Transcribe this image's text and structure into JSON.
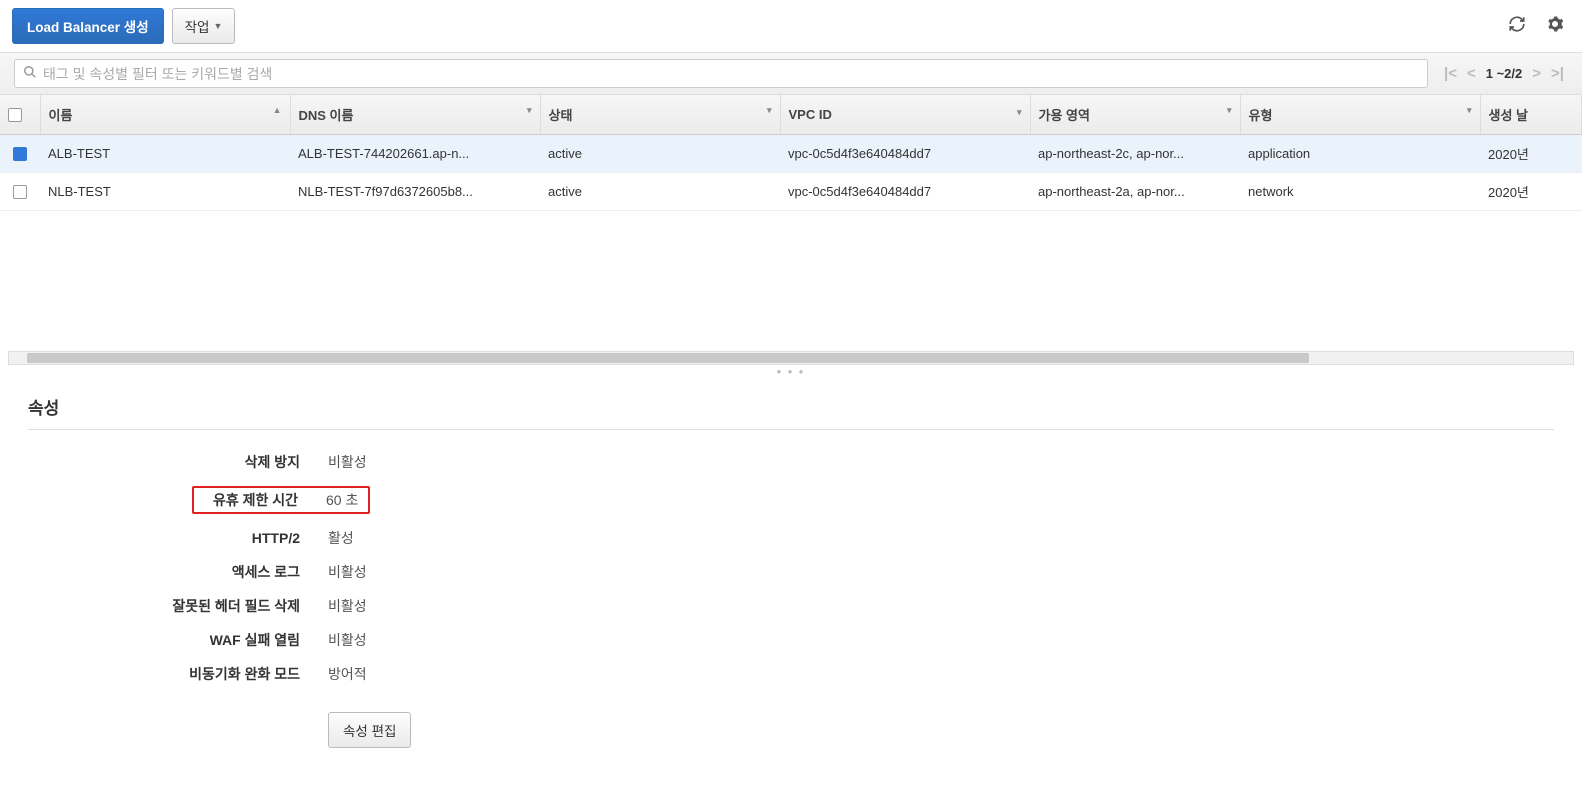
{
  "toolbar": {
    "create_label": "Load Balancer 생성",
    "actions_label": "작업"
  },
  "search": {
    "placeholder": "태그 및 속성별 필터 또는 키워드별 검색"
  },
  "pager": {
    "text": "1 ~2/2"
  },
  "columns": {
    "name": "이름",
    "dns": "DNS 이름",
    "state": "상태",
    "vpc": "VPC ID",
    "az": "가용 영역",
    "type": "유형",
    "created": "생성 날"
  },
  "rows": [
    {
      "selected": true,
      "name": "ALB-TEST",
      "dns": "ALB-TEST-744202661.ap-n...",
      "state": "active",
      "vpc": "vpc-0c5d4f3e640484dd7",
      "az": "ap-northeast-2c, ap-nor...",
      "type": "application",
      "created": "2020년"
    },
    {
      "selected": false,
      "name": "NLB-TEST",
      "dns": "NLB-TEST-7f97d6372605b8...",
      "state": "active",
      "vpc": "vpc-0c5d4f3e640484dd7",
      "az": "ap-northeast-2a, ap-nor...",
      "type": "network",
      "created": "2020년"
    }
  ],
  "details": {
    "title": "속성",
    "delete_protection": {
      "label": "삭제 방지",
      "value": "비활성"
    },
    "idle_timeout": {
      "label": "유휴 제한 시간",
      "value": "60 초"
    },
    "http2": {
      "label": "HTTP/2",
      "value": "활성"
    },
    "access_logs": {
      "label": "액세스 로그",
      "value": "비활성"
    },
    "drop_invalid_headers": {
      "label": "잘못된 헤더 필드 삭제",
      "value": "비활성"
    },
    "waf_fail_open": {
      "label": "WAF 실패 열림",
      "value": "비활성"
    },
    "desync_mode": {
      "label": "비동기화 완화 모드",
      "value": "방어적"
    },
    "edit_button": "속성 편집"
  }
}
